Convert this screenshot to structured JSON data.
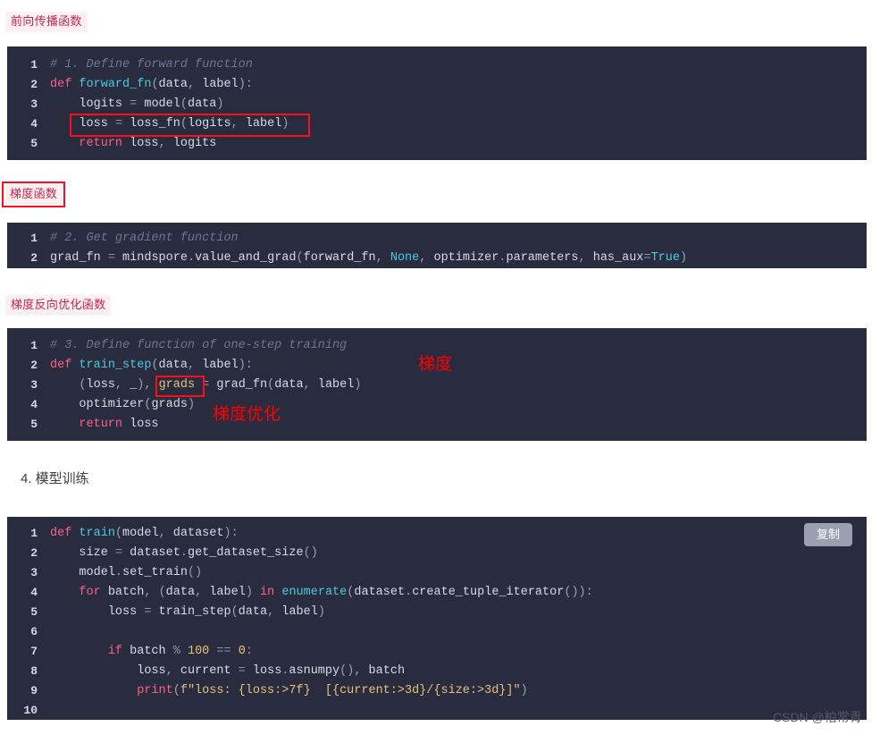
{
  "annotations": {
    "label_forward": "前向传播函数",
    "label_gradient": "梯度函数",
    "label_backward_opt": "梯度反向优化函数",
    "note_grads": "梯度",
    "note_grad_opt": "梯度优化"
  },
  "heading": {
    "section4": "4. 模型训练"
  },
  "buttons": {
    "copy": "复制"
  },
  "watermark": {
    "text": "CSDN @柏常青"
  },
  "colors": {
    "code_background": "#282c3e",
    "annotation_red": "#fc0d1c",
    "note_red": "#ff0000",
    "tag_text": "#c7254e",
    "tag_background": "#fdf0f3",
    "keyword": "#ff5f87",
    "function": "#4ec9e0",
    "comment": "#6d7694",
    "string": "#e8c07d",
    "plain_text": "#d8dbe6",
    "page_background": "#ffffff"
  },
  "code_blocks": [
    {
      "id": "forward-fn",
      "line_numbers": [
        "1",
        "2",
        "3",
        "4",
        "5"
      ],
      "lines": [
        "# 1. Define forward function",
        "def forward_fn(data, label):",
        "    logits = model(data)",
        "    loss = loss_fn(logits, label)",
        "    return loss, logits"
      ]
    },
    {
      "id": "gradient-fn",
      "line_numbers": [
        "1",
        "2"
      ],
      "lines": [
        "# 2. Get gradient function",
        "grad_fn = mindspore.value_and_grad(forward_fn, None, optimizer.parameters, has_aux=True)"
      ]
    },
    {
      "id": "train-step-fn",
      "line_numbers": [
        "1",
        "2",
        "3",
        "4",
        "5"
      ],
      "lines": [
        "# 3. Define function of one-step training",
        "def train_step(data, label):",
        "    (loss, _), grads = grad_fn(data, label)",
        "    optimizer(grads)",
        "    return loss"
      ]
    },
    {
      "id": "train-loop",
      "line_numbers": [
        "1",
        "2",
        "3",
        "4",
        "5",
        "6",
        "7",
        "8",
        "9",
        "10"
      ],
      "lines": [
        "def train(model, dataset):",
        "    size = dataset.get_dataset_size()",
        "    model.set_train()",
        "    for batch, (data, label) in enumerate(dataset.create_tuple_iterator()):",
        "        loss = train_step(data, label)",
        "",
        "        if batch % 100 == 0:",
        "            loss, current = loss.asnumpy(), batch",
        "            print(f\"loss: {loss:>7f}  [{current:>3d}/{size:>3d}]\")",
        ""
      ]
    }
  ]
}
